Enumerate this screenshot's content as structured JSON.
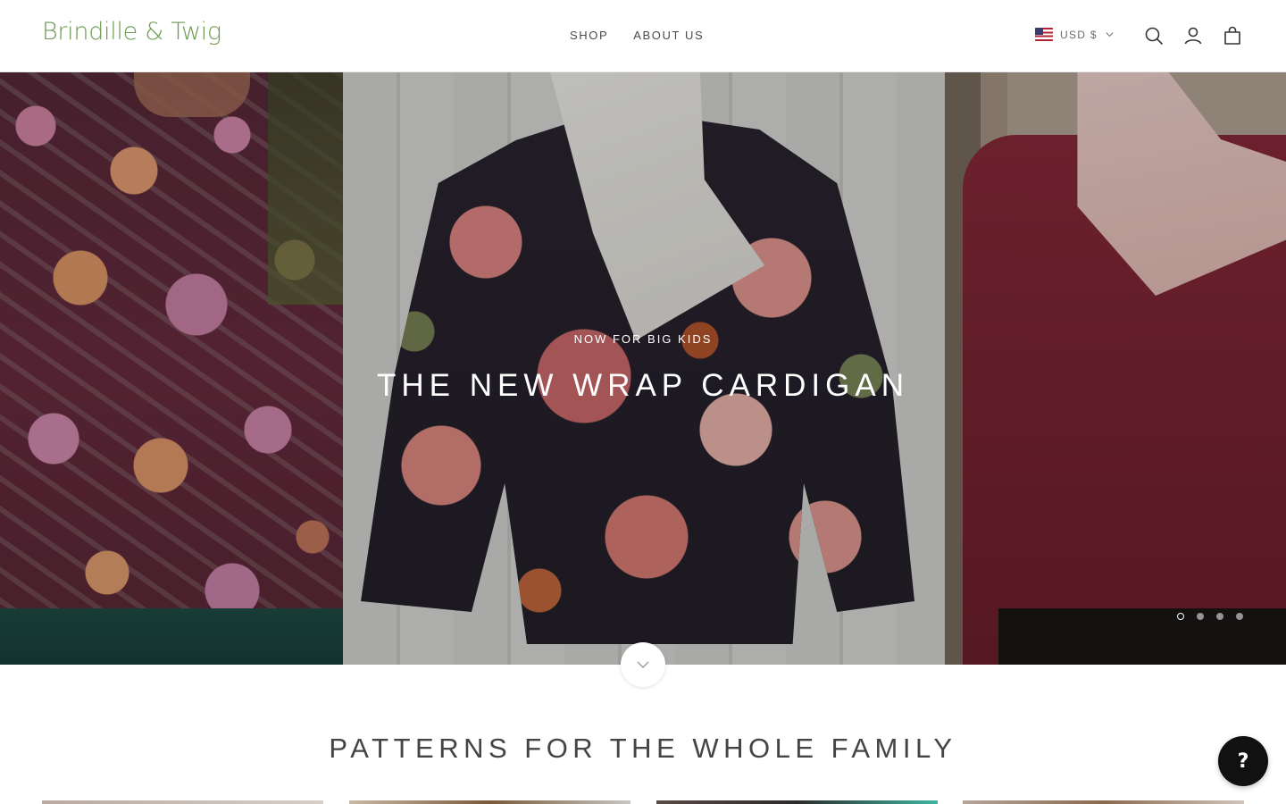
{
  "header": {
    "logo": "Brindille & Twig",
    "nav": [
      "SHOP",
      "ABOUT US"
    ],
    "currency": "USD $",
    "icons": [
      "us-flag-icon",
      "chevron-down-icon",
      "search-icon",
      "account-icon",
      "cart-icon"
    ]
  },
  "hero": {
    "eyebrow": "NOW FOR BIG KIDS",
    "title": "THE NEW WRAP CARDIGAN",
    "slides_count": 4,
    "active_slide": 1
  },
  "section": {
    "title": "PATTERNS FOR THE WHOLE FAMILY"
  },
  "help": {
    "label": "?"
  },
  "colors": {
    "logo_green": "#6e9a54",
    "text_dark": "#444444",
    "help_button": "#111111"
  }
}
